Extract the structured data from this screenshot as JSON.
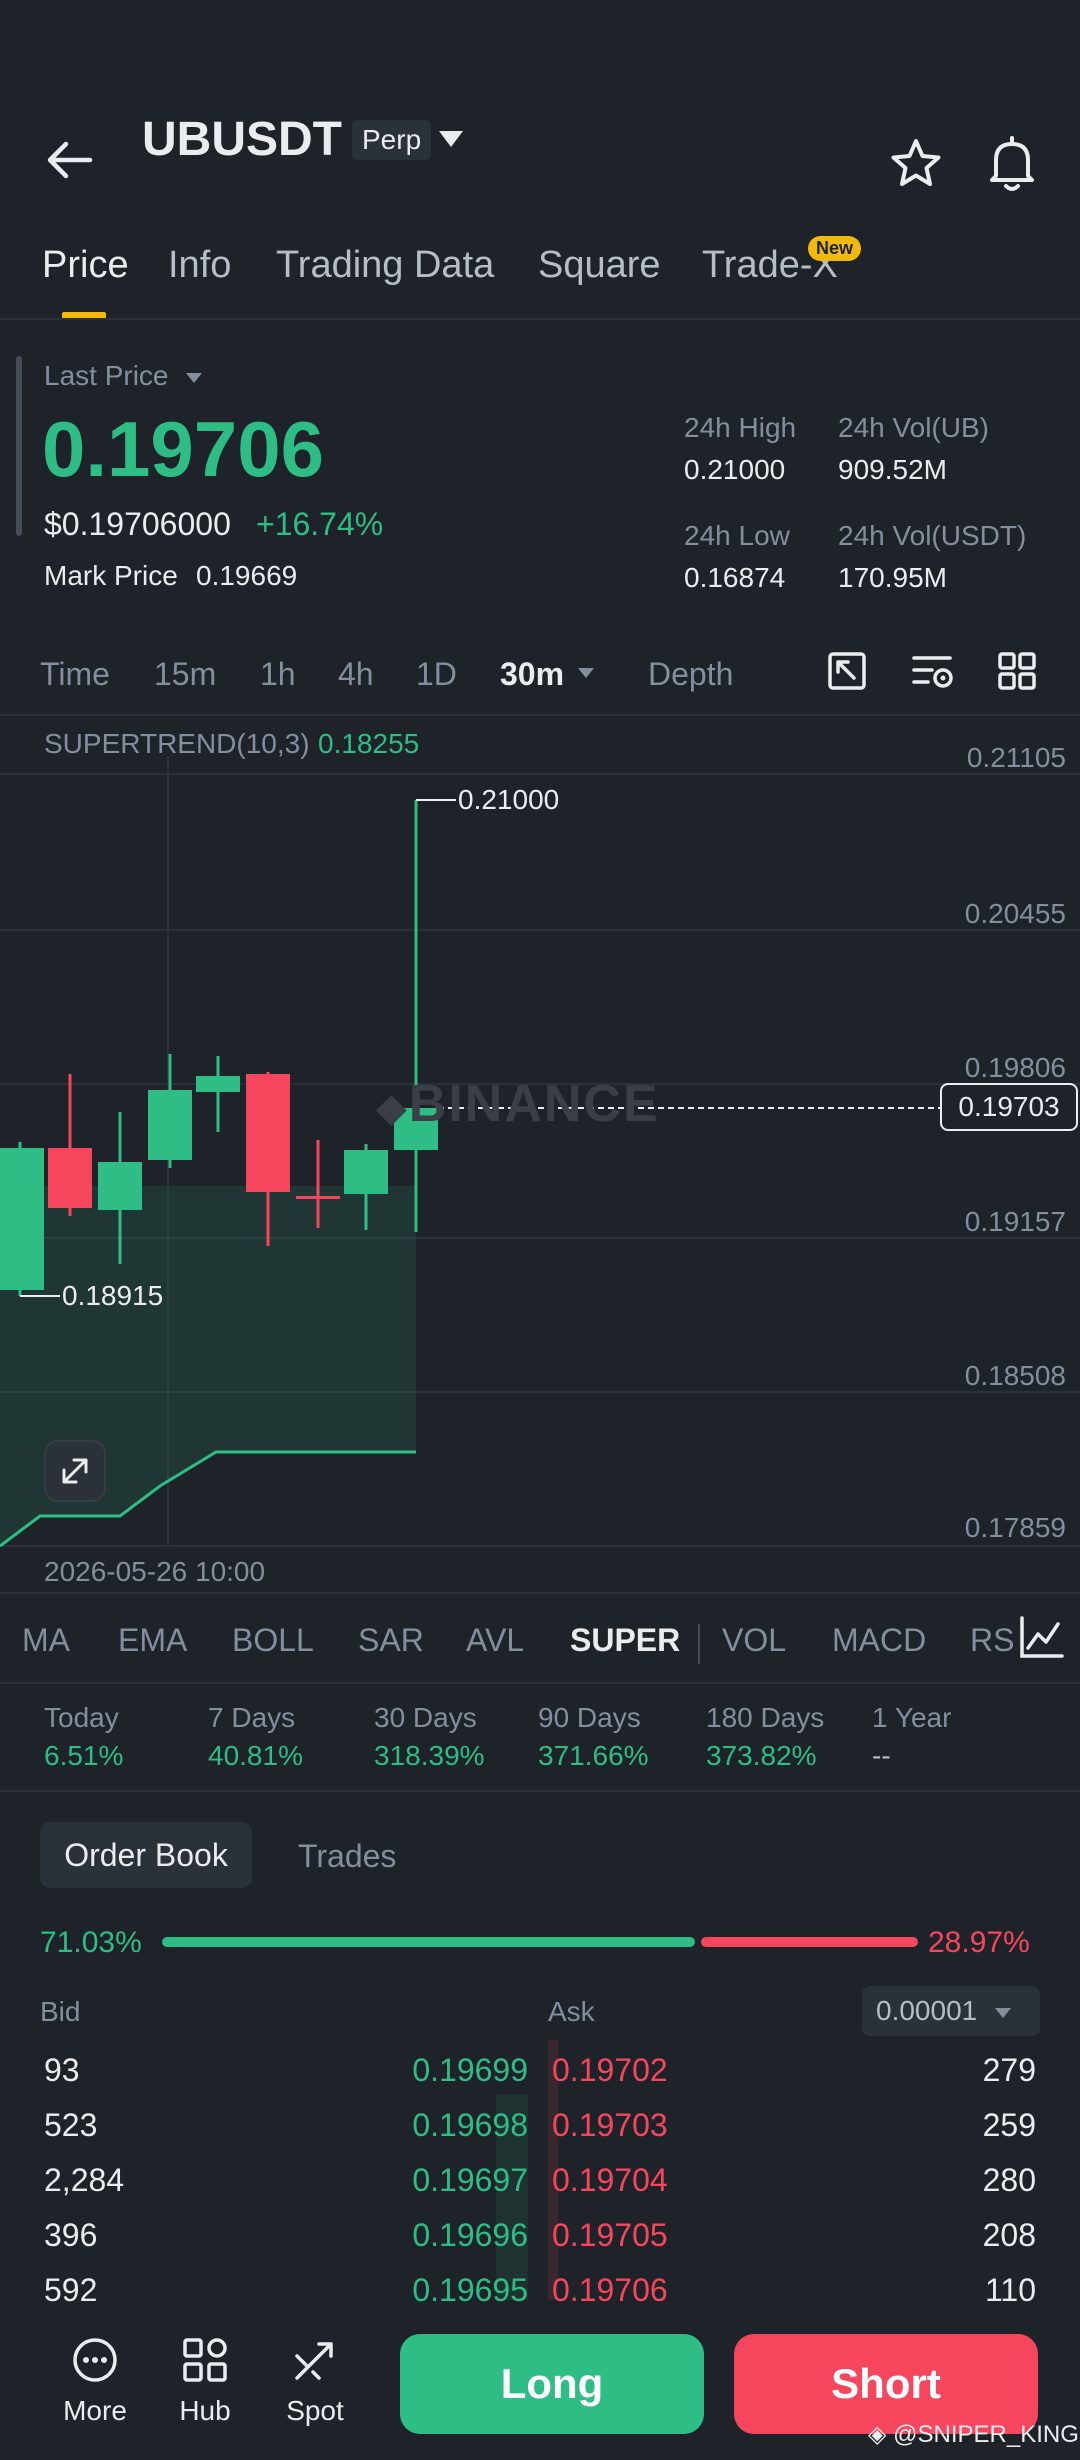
{
  "header": {
    "symbol": "UBUSDT",
    "contract_type": "Perp"
  },
  "tabs": [
    {
      "label": "Price"
    },
    {
      "label": "Info"
    },
    {
      "label": "Trading Data"
    },
    {
      "label": "Square"
    },
    {
      "label": "Trade-X"
    }
  ],
  "new_badge": "New",
  "price": {
    "last_price_label": "Last Price",
    "last_price": "0.19706",
    "usd_price": "$0.19706000",
    "change": "+16.74%",
    "mark_label": "Mark Price",
    "mark_value": "0.19669"
  },
  "stats": {
    "high_label": "24h High",
    "high": "0.21000",
    "low_label": "24h Low",
    "low": "0.16874",
    "vol_base_label": "24h Vol(UB)",
    "vol_base": "909.52M",
    "vol_quote_label": "24h Vol(USDT)",
    "vol_quote": "170.95M"
  },
  "timeframes": [
    "Time",
    "15m",
    "1h",
    "4h",
    "1D",
    "30m",
    "Depth"
  ],
  "indicator_overlay": {
    "name": "SUPERTREND(10,3)",
    "value": "0.18255"
  },
  "chart": {
    "y_ticks": [
      "0.21105",
      "0.20455",
      "0.19806",
      "0.19157",
      "0.18508",
      "0.17859"
    ],
    "current_price": "0.19703",
    "high_label": "0.21000",
    "low_label": "0.18915",
    "date_label": "2026-05-26 10:00",
    "watermark": "BINANCE",
    "colors": {
      "up": "#2ebd85",
      "down": "#f6465d",
      "background": "#1e2329"
    }
  },
  "indicators": [
    "MA",
    "EMA",
    "BOLL",
    "SAR",
    "AVL",
    "SUPER",
    "VOL",
    "MACD",
    "RS"
  ],
  "performance": [
    {
      "label": "Today",
      "value": "6.51%"
    },
    {
      "label": "7 Days",
      "value": "40.81%"
    },
    {
      "label": "30 Days",
      "value": "318.39%"
    },
    {
      "label": "90 Days",
      "value": "371.66%"
    },
    {
      "label": "180 Days",
      "value": "373.82%"
    },
    {
      "label": "1 Year",
      "value": "--"
    }
  ],
  "order_book": {
    "tab_order_book": "Order Book",
    "tab_trades": "Trades",
    "bid_pct": "71.03%",
    "ask_pct": "28.97%",
    "bid_ratio": 0.7103,
    "bid_header": "Bid",
    "ask_header": "Ask",
    "precision": "0.00001",
    "rows": [
      {
        "bid_qty": "93",
        "bid_price": "0.19699",
        "ask_price": "0.19702",
        "ask_qty": "279"
      },
      {
        "bid_qty": "523",
        "bid_price": "0.19698",
        "ask_price": "0.19703",
        "ask_qty": "259"
      },
      {
        "bid_qty": "2,284",
        "bid_price": "0.19697",
        "ask_price": "0.19704",
        "ask_qty": "280"
      },
      {
        "bid_qty": "396",
        "bid_price": "0.19696",
        "ask_price": "0.19705",
        "ask_qty": "208"
      },
      {
        "bid_qty": "592",
        "bid_price": "0.19695",
        "ask_price": "0.19706",
        "ask_qty": "110"
      }
    ]
  },
  "bottom_nav": {
    "more": "More",
    "hub": "Hub",
    "spot": "Spot",
    "long": "Long",
    "short": "Short"
  },
  "credit": "@SNIPER_KING"
}
